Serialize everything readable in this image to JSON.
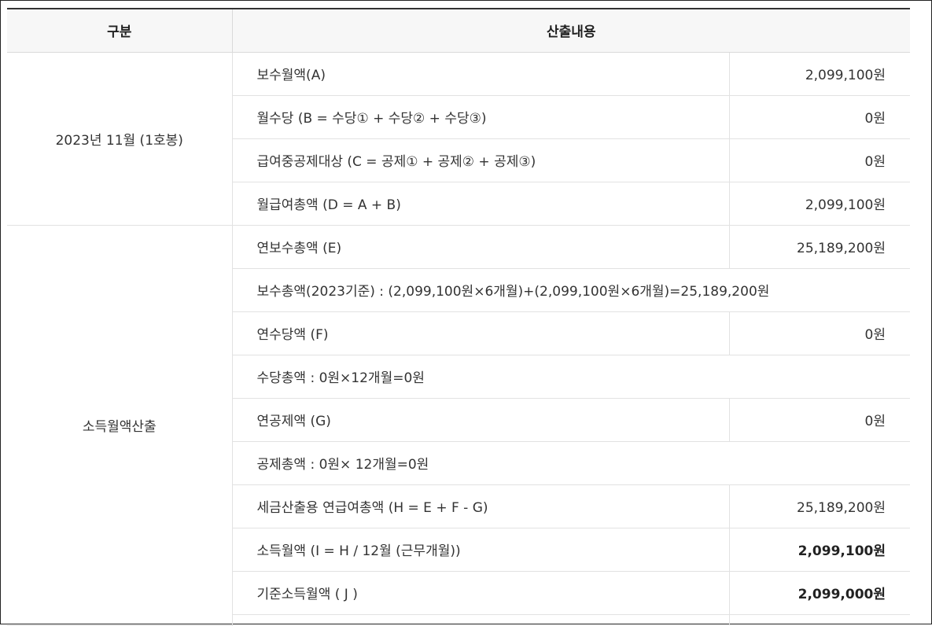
{
  "header": {
    "col_category": "구분",
    "col_content": "산출내용"
  },
  "section1": {
    "category": "2023년 11월 (1호봉)",
    "rows": [
      {
        "label": "보수월액(A)",
        "value": "2,099,100원"
      },
      {
        "label": "월수당 (B = 수당① + 수당② + 수당③)",
        "value": "0원"
      },
      {
        "label": "급여중공제대상 (C = 공제① + 공제② + 공제③)",
        "value": "0원"
      },
      {
        "label": "월급여총액 (D = A + B)",
        "value": "2,099,100원"
      }
    ]
  },
  "section2": {
    "category": "소득월액산출",
    "rows": [
      {
        "label": "연보수총액 (E)",
        "value": "25,189,200원"
      },
      {
        "note": "보수총액(2023기준) : (2,099,100원×6개월)+(2,099,100원×6개월)=25,189,200원"
      },
      {
        "label": "연수당액 (F)",
        "value": "0원"
      },
      {
        "note": "수당총액 : 0원×12개월=0원"
      },
      {
        "label": "연공제액 (G)",
        "value": "0원"
      },
      {
        "note": "공제총액 : 0원× 12개월=0원"
      },
      {
        "label": "세금산출용 연급여총액 (H = E + F - G)",
        "value": "25,189,200원"
      },
      {
        "label": "소득월액 (I = H / 12월 (근무개월))",
        "value": "2,099,100원"
      },
      {
        "label": "기준소득월액 ( J )",
        "value": "2,099,000원"
      }
    ]
  }
}
